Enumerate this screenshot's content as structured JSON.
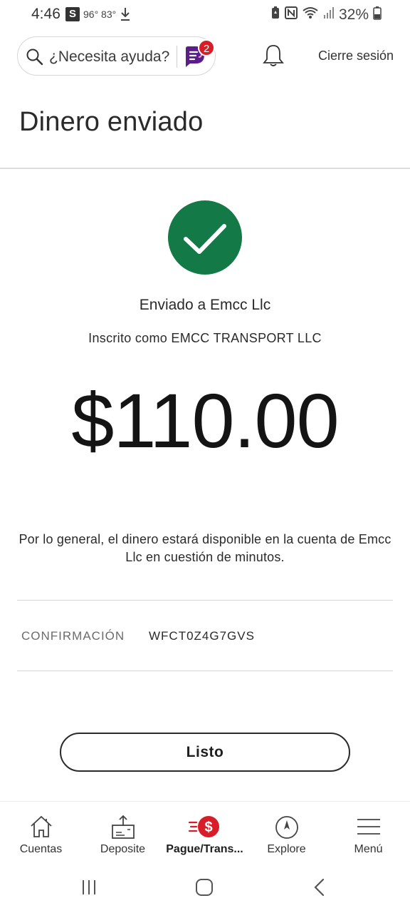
{
  "status_bar": {
    "time": "4:46",
    "s_badge": "S",
    "temps": "96° 83°",
    "battery_pct": "32%"
  },
  "header": {
    "search_placeholder": "¿Necesita ayuda?",
    "notification_count": "2",
    "logout_label": "Cierre sesión"
  },
  "page": {
    "title": "Dinero enviado"
  },
  "confirmation": {
    "sent_to": "Enviado a Emcc Llc",
    "enrolled_as": "Inscrito como EMCC TRANSPORT LLC",
    "amount": "$110.00",
    "availability_note": "Por lo general, el dinero estará disponible en la cuenta de Emcc Llc en cuestión de minutos.",
    "confirmation_label": "CONFIRMACIÓN",
    "confirmation_number": "WFCT0Z4G7GVS",
    "done_label": "Listo"
  },
  "bottom_nav": {
    "items": [
      {
        "label": "Cuentas",
        "icon": "home-icon"
      },
      {
        "label": "Deposite",
        "icon": "deposit-icon"
      },
      {
        "label": "Pague/Trans...",
        "icon": "pay-transfer-icon",
        "active": true
      },
      {
        "label": "Explore",
        "icon": "compass-icon"
      },
      {
        "label": "Menú",
        "icon": "menu-icon"
      }
    ]
  },
  "colors": {
    "success_green": "#137a47",
    "brand_red": "#d71e28",
    "brand_purple": "#5a1d8a"
  }
}
